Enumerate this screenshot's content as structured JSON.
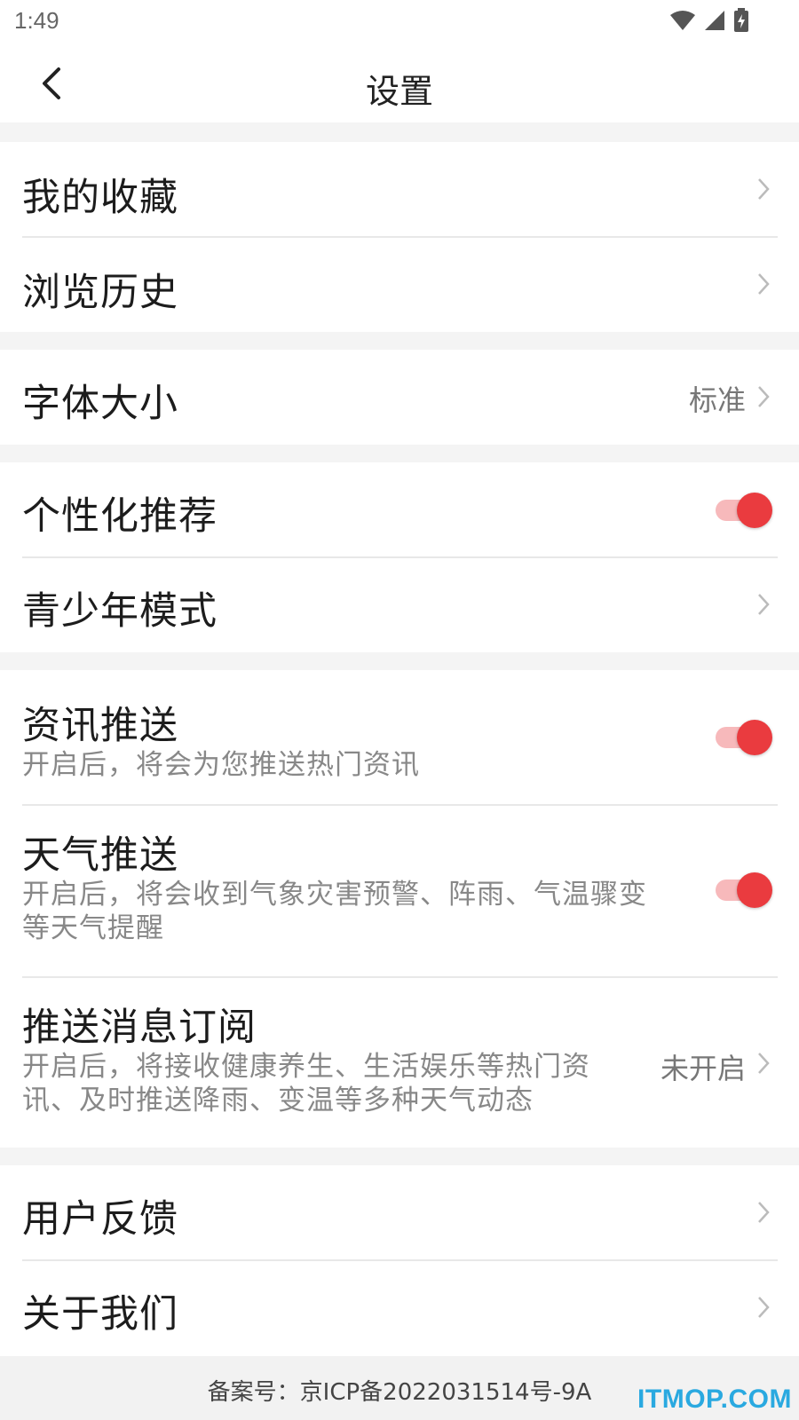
{
  "status_bar": {
    "time": "1:49"
  },
  "header": {
    "title": "设置"
  },
  "groups": {
    "g1": {
      "favorites": {
        "label": "我的收藏"
      },
      "history": {
        "label": "浏览历史"
      }
    },
    "g2": {
      "font_size": {
        "label": "字体大小",
        "value": "标准"
      }
    },
    "g3": {
      "personalized": {
        "label": "个性化推荐",
        "enabled": true
      },
      "youth_mode": {
        "label": "青少年模式"
      }
    },
    "g4": {
      "news_push": {
        "label": "资讯推送",
        "desc": "开启后，将会为您推送热门资讯",
        "enabled": true
      },
      "weather_push": {
        "label": "天气推送",
        "desc_line1": "开启后，将会收到气象灾害预警、阵雨、气温骤变",
        "desc_line2": "等天气提醒",
        "enabled": true
      },
      "subscription": {
        "label": "推送消息订阅",
        "desc_line1": "开启后，将接收健康养生、生活娱乐等热门资",
        "desc_line2": "讯、及时推送降雨、变温等多种天气动态",
        "value": "未开启"
      }
    },
    "g5": {
      "feedback": {
        "label": "用户反馈"
      },
      "about": {
        "label": "关于我们"
      }
    }
  },
  "footer": {
    "icp": "备案号：京ICP备2022031514号-9A"
  },
  "watermark": "ITMOP.COM",
  "colors": {
    "accent": "#ea3b3f",
    "track": "#f7b9bb",
    "watermark": "#2aa9e0"
  }
}
